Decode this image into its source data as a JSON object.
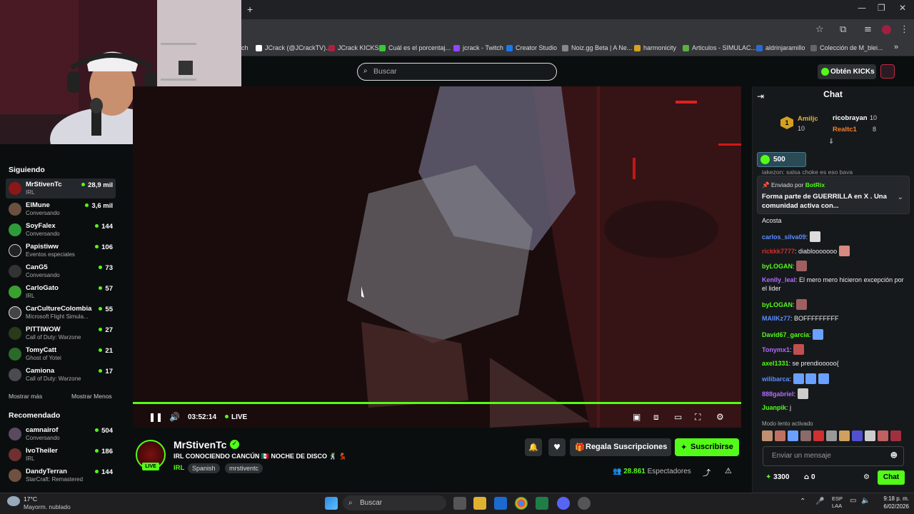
{
  "browser": {
    "new_tab": "+",
    "bookmarks": [
      "ch",
      "JCrack (@JCrackTV)...",
      "JCrack KICKS",
      "Cuál es el porcentaj...",
      "jcrack - Twitch",
      "Creator Studio",
      "Noiz.gg Beta | A Ne...",
      "harmonicity",
      "Articulos - SIMULAC...",
      "aldrinjaramillo",
      "Colección de M_blei..."
    ],
    "overflow": "»"
  },
  "topbar": {
    "search_placeholder": "Buscar",
    "get_kicks_label": "Obtén KICKs"
  },
  "sidebar": {
    "following_title": "Siguiendo",
    "following": [
      {
        "name": "MrStivenTc",
        "category": "IRL",
        "viewers": "28,9 mil",
        "color": "#8a1818"
      },
      {
        "name": "ElMune",
        "category": "Conversando",
        "viewers": "3,6 mil",
        "color": "#6b5040"
      },
      {
        "name": "SoyFalex",
        "category": "Conversando",
        "viewers": "144",
        "color": "#2f9a3a"
      },
      {
        "name": "Papistiww",
        "category": "Eventos especiales",
        "viewers": "106",
        "color": "#222222"
      },
      {
        "name": "CanG5",
        "category": "Conversando",
        "viewers": "73",
        "color": "#333333"
      },
      {
        "name": "CarloGato",
        "category": "IRL",
        "viewers": "57",
        "color": "#3aa030"
      },
      {
        "name": "CarCultureColombia",
        "category": "Microsoft Flight Simula...",
        "viewers": "55",
        "color": "#444444"
      },
      {
        "name": "PITTIWOW",
        "category": "Call of Duty: Warzone",
        "viewers": "27",
        "color": "#2a3a1a"
      },
      {
        "name": "TomyCatt",
        "category": "Ghost of Yotei",
        "viewers": "21",
        "color": "#2a6a2a"
      },
      {
        "name": "Camiona",
        "category": "Call of Duty: Warzone",
        "viewers": "17",
        "color": "#4a4a50"
      }
    ],
    "show_more": "Mostrar más",
    "show_less": "Mostrar Menos",
    "recommended_title": "Recomendado",
    "recommended": [
      {
        "name": "camnairof",
        "category": "Conversando",
        "viewers": "504",
        "color": "#5a4a60"
      },
      {
        "name": "IvoTheiler",
        "category": "IRL",
        "viewers": "186",
        "color": "#703030"
      },
      {
        "name": "DandyTerran",
        "category": "StarCraft: Remastered",
        "viewers": "144",
        "color": "#705040"
      }
    ]
  },
  "player": {
    "time": "03:52:14",
    "live_label": "LIVE"
  },
  "stream": {
    "streamer": "MrStivenTc",
    "live_badge": "LIVE",
    "title": "IRL CONOCIENDO CANCÚN 🇲🇽 NOCHE DE DISCO 🕺 💃",
    "category": "IRL",
    "tags": [
      "Spanish",
      "mrstiventc"
    ],
    "gift_label": "Regala Suscripciones",
    "subscribe_label": "Suscribirse",
    "viewers_count": "28.861",
    "viewers_label": "Espectadores"
  },
  "chat": {
    "title": "Chat",
    "leaderboard": [
      {
        "rank": "1",
        "name": "Amiljc",
        "value": "10"
      },
      {
        "name": "ricobrayan",
        "value": "10"
      },
      {
        "name": "Realtc1",
        "value": "8"
      }
    ],
    "kicks_goal": "500",
    "partial_line": "jakezon: salsa choke es eso baya",
    "pinned_by_label": "Enviado por",
    "pinned_by": "BotRix",
    "pinned_text": "Forma parte de GUERRILLA en X . Una comunidad activa con...",
    "messages": [
      {
        "user": "",
        "text": "Acosta",
        "color": "#ffffff"
      },
      {
        "user": "carlos_silva09",
        "text": ":",
        "color": "#5b8cff"
      },
      {
        "user": "rickkk7777",
        "text": ": diablooooooo",
        "color": "#e02a2a"
      },
      {
        "user": "byLOGAN",
        "text": ":",
        "color": "#53fc18"
      },
      {
        "user": "Kenlly_leal",
        "text": ": El mero mero hicieron excepción por el lider",
        "color": "#b36bff"
      },
      {
        "user": "byLOGAN",
        "text": ":",
        "color": "#53fc18"
      },
      {
        "user": "MAIIKz77",
        "text": ": BOFFFFFFFFF",
        "color": "#5b8cff"
      },
      {
        "user": "David67_garcia",
        "text": ":",
        "color": "#53fc18"
      },
      {
        "user": "Tonymx1",
        "text": ":",
        "color": "#b36bff"
      },
      {
        "user": "axel1331",
        "text": ": se prendiooooo{",
        "color": "#53fc18"
      },
      {
        "user": "wilibarca",
        "text": ":",
        "color": "#5b8cff"
      },
      {
        "user": "888gabriel",
        "text": ":",
        "color": "#b36bff"
      },
      {
        "user": "Juanpik",
        "text": ": j",
        "color": "#53fc18"
      }
    ],
    "slow_mode": "Modo lento activado",
    "input_placeholder": "Enviar un mensaje",
    "balance": "3300",
    "gifts": "0",
    "send_label": "Chat"
  },
  "taskbar": {
    "weather_temp": "17°C",
    "weather_desc": "Mayorm. nublado",
    "search_label": "Buscar",
    "lang_1": "ESP",
    "lang_2": "LAA",
    "clock_time": "9:18 p. m.",
    "clock_date": "6/02/2026"
  },
  "colors": {
    "accent": "#53fc18",
    "bg": "#0b0e0f",
    "panel": "#16191b"
  }
}
